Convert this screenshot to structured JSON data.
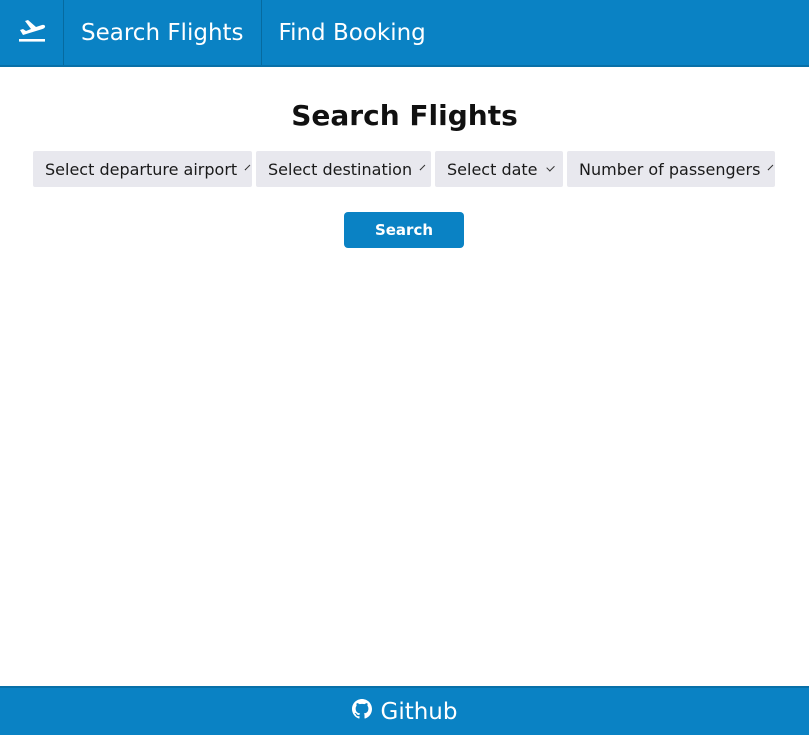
{
  "nav": {
    "logo_icon": "flight-takeoff-icon",
    "items": [
      {
        "label": "Search Flights"
      },
      {
        "label": "Find Booking"
      }
    ]
  },
  "main": {
    "title": "Search Flights",
    "selects": [
      {
        "value": "Select departure airport"
      },
      {
        "value": "Select destination"
      },
      {
        "value": "Select date"
      },
      {
        "value": "Number of passengers"
      }
    ],
    "search_button": "Search"
  },
  "footer": {
    "link_label": "Github",
    "icon": "github-icon"
  },
  "colors": {
    "brand": "#0a82c4",
    "select_bg": "#e8e8ee"
  }
}
